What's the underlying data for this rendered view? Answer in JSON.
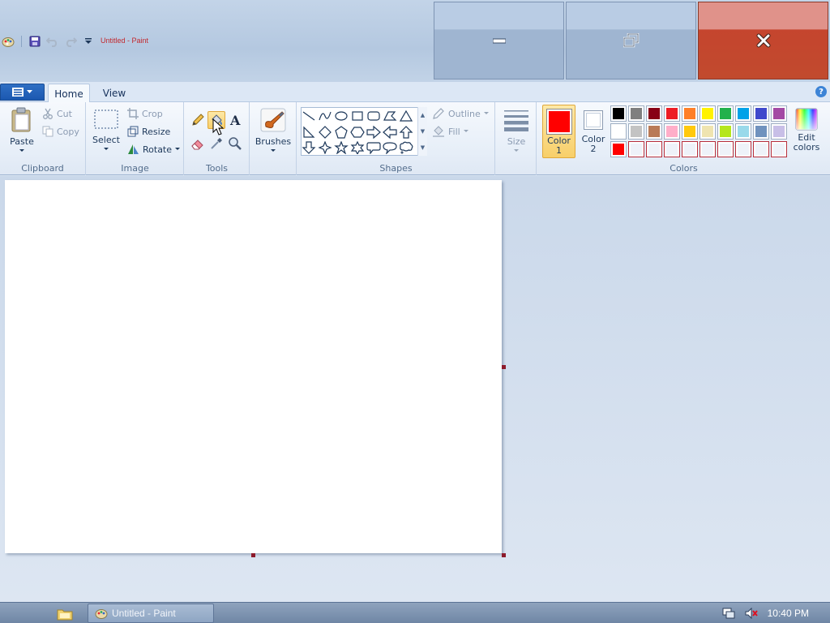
{
  "window": {
    "title": "Untitled - Paint"
  },
  "tabs": [
    {
      "label": "Home"
    },
    {
      "label": "View"
    }
  ],
  "clipboard": {
    "paste": "Paste",
    "cut": "Cut",
    "copy": "Copy",
    "group": "Clipboard"
  },
  "image": {
    "select": "Select",
    "crop": "Crop",
    "resize": "Resize",
    "rotate": "Rotate",
    "group": "Image"
  },
  "tools": {
    "group": "Tools",
    "selected": "fill-bucket"
  },
  "brushes": {
    "label": "Brushes"
  },
  "shapes": {
    "outline": "Outline",
    "fill": "Fill",
    "group": "Shapes"
  },
  "size": {
    "label": "Size"
  },
  "colors": {
    "color1_line1": "Color",
    "color1_line2": "1",
    "color2_line1": "Color",
    "color2_line2": "2",
    "edit_line1": "Edit",
    "edit_line2": "colors",
    "group": "Colors",
    "color1_value": "#ff0000",
    "color2_value": "#ffffff",
    "palette": [
      "#000000",
      "#7f7f7f",
      "#880015",
      "#ed1c24",
      "#ff7f27",
      "#fff200",
      "#22b14c",
      "#00a2e8",
      "#3f48cc",
      "#a349a4",
      "#ffffff",
      "#c3c3c3",
      "#b97a57",
      "#ffaec9",
      "#ffc90e",
      "#efe4b0",
      "#b5e61d",
      "#99d9ea",
      "#7092be",
      "#c8bfe7",
      "#ff0000",
      "#ffffff",
      "#ffffff",
      "#ffffff",
      "#ffffff",
      "#ffffff",
      "#ffffff",
      "#ffffff",
      "#ffffff",
      "#ffffff"
    ]
  },
  "taskbar": {
    "task_label": "Untitled - Paint",
    "clock": "10:40 PM"
  }
}
